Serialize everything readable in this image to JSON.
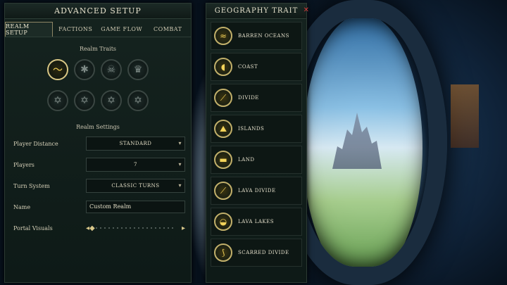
{
  "advanced_setup": {
    "title": "ADVANCED SETUP",
    "tabs": [
      {
        "label": "REALM SETUP",
        "active": true
      },
      {
        "label": "FACTIONS",
        "active": false
      },
      {
        "label": "GAME FLOW",
        "active": false
      },
      {
        "label": "COMBAT",
        "active": false
      }
    ],
    "realm_traits_label": "Realm Traits",
    "trait_slots": [
      {
        "icon": "wave-geography-icon",
        "selected": true
      },
      {
        "icon": "spider-trait-icon",
        "selected": false
      },
      {
        "icon": "skull-trait-icon",
        "selected": false
      },
      {
        "icon": "crown-trait-icon",
        "selected": false
      },
      {
        "icon": "empty-slot-icon",
        "selected": false
      },
      {
        "icon": "empty-slot-icon",
        "selected": false
      },
      {
        "icon": "empty-slot-icon",
        "selected": false
      },
      {
        "icon": "empty-slot-icon",
        "selected": false
      }
    ],
    "realm_settings_label": "Realm Settings",
    "settings": {
      "player_distance": {
        "label": "Player Distance",
        "value": "STANDARD"
      },
      "players": {
        "label": "Players",
        "value": "7"
      },
      "turn_system": {
        "label": "Turn System",
        "value": "CLASSIC TURNS"
      },
      "name": {
        "label": "Name",
        "value": "Custom Realm"
      },
      "portal_visuals": {
        "label": "Portal Visuals"
      }
    }
  },
  "geography_trait": {
    "title": "GEOGRAPHY TRAIT",
    "items": [
      {
        "label": "BARREN OCEANS",
        "icon": "barren-oceans-icon"
      },
      {
        "label": "COAST",
        "icon": "coast-icon"
      },
      {
        "label": "DIVIDE",
        "icon": "divide-icon"
      },
      {
        "label": "ISLANDS",
        "icon": "islands-icon"
      },
      {
        "label": "LAND",
        "icon": "land-icon"
      },
      {
        "label": "LAVA DIVIDE",
        "icon": "lava-divide-icon"
      },
      {
        "label": "LAVA LAKES",
        "icon": "lava-lakes-icon"
      },
      {
        "label": "SCARRED DIVIDE",
        "icon": "scarred-divide-icon"
      }
    ]
  },
  "colors": {
    "accent_gold": "#f3d35a",
    "close_red": "#d33a3a",
    "panel_bg": "#15231f"
  }
}
